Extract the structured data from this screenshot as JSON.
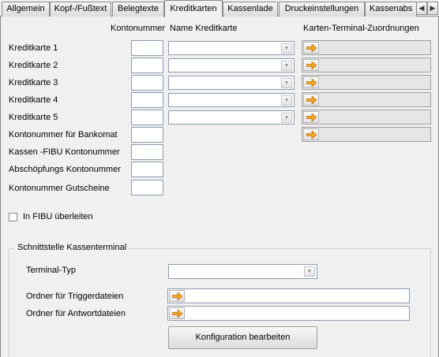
{
  "tabs": [
    {
      "label": "Allgemein"
    },
    {
      "label": "Kopf-/Fußtext"
    },
    {
      "label": "Belegtexte"
    },
    {
      "label": "Kreditkarten"
    },
    {
      "label": "Kassenlade"
    },
    {
      "label": "Druckeinstellungen"
    },
    {
      "label": "Kassenabs"
    }
  ],
  "active_tab": "Kreditkarten",
  "headers": {
    "kontonummer": "Kontonummer",
    "name_kreditkarte": "Name Kreditkarte",
    "terminal": "Karten-Terminal-Zuordnungen"
  },
  "rows": [
    {
      "label": "Kreditkarte 1",
      "konto": "",
      "name": ""
    },
    {
      "label": "Kreditkarte 2",
      "konto": "",
      "name": ""
    },
    {
      "label": "Kreditkarte 3",
      "konto": "",
      "name": ""
    },
    {
      "label": "Kreditkarte 4",
      "konto": "",
      "name": ""
    },
    {
      "label": "Kreditkarte 5",
      "konto": "",
      "name": ""
    },
    {
      "label": "Kontonummer für Bankomat",
      "konto": ""
    },
    {
      "label": "Kassen -FIBU Kontonummer",
      "konto": ""
    },
    {
      "label": "Abschöpfungs Kontonummer",
      "konto": ""
    },
    {
      "label": "Kontonummer Gutscheine",
      "konto": ""
    }
  ],
  "fibu": {
    "label": "In FIBU überleiten",
    "checked": false
  },
  "kassenterminal": {
    "title": "Schnittstelle Kassenterminal",
    "terminal_typ_label": "Terminal-Typ",
    "terminal_typ_value": "",
    "trigger_label": "Ordner für Triggerdateien",
    "trigger_value": "",
    "antwort_label": "Ordner für Antwortdateien",
    "antwort_value": "",
    "config_button": "Konfiguration bearbeiten"
  },
  "icons": {
    "tab_prev": "chevron-left-icon",
    "tab_next": "chevron-right-icon",
    "assign": "arrow-right-icon",
    "dropdown": "chevron-down-icon"
  },
  "colors": {
    "arrow": "#f5a623",
    "field_border": "#8c9bb0"
  }
}
